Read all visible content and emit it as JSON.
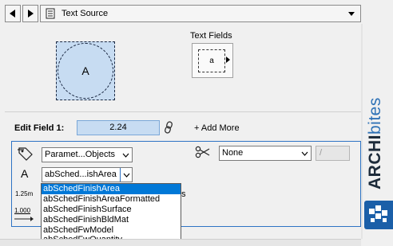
{
  "header": {
    "prev_icon": "triangle-left-icon",
    "next_icon": "triangle-right-icon",
    "source_icon": "document-icon",
    "title": "Text Source",
    "expand_icon": "chevron-down-icon"
  },
  "brand": {
    "archi": "ARCHI",
    "bites": "bites",
    "logo_icon": "archibites-logo-icon"
  },
  "preview": {
    "symbol_label": "A",
    "text_fields_title": "Text Fields",
    "text_field_cell": "a"
  },
  "edit": {
    "label": "Edit Field 1:",
    "value": "2.24",
    "link_icon": "chain-link-icon",
    "add_more": "+ Add More"
  },
  "field": {
    "source_select": "Paramet...Objects",
    "transform_select": "None",
    "separator": "/",
    "parameter_select": "abSched...ishArea",
    "font_icon_glyph": "A",
    "size_label": "1.25m",
    "spacing_label": "1.000",
    "partial_text": "s"
  },
  "dropdown": {
    "options": [
      "abSchedFinishArea",
      "abSchedFinishAreaFormatted",
      "abSchedFinishSurface",
      "abSchedFinishBldMat",
      "abSchedFwModel",
      "abSchedFwQuantity"
    ],
    "selected_index": 0
  },
  "colors": {
    "accent": "#2e73c4",
    "selection": "#0078d7",
    "preview_fill": "#c7dcf2",
    "brand_dark": "#1d2b3a",
    "brand_blue": "#2f72b6"
  }
}
